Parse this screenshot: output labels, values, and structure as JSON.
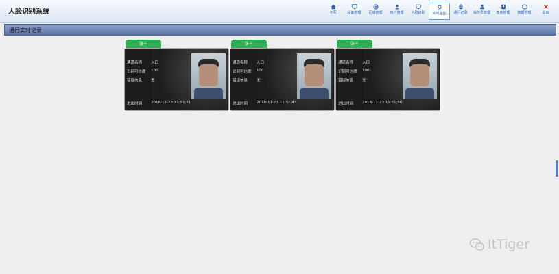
{
  "app": {
    "title": "人脸识别系统"
  },
  "nav": [
    {
      "label": "主页",
      "icon": "home-icon"
    },
    {
      "label": "设备管理",
      "icon": "monitor-icon"
    },
    {
      "label": "区域管理",
      "icon": "area-icon"
    },
    {
      "label": "用户管理",
      "icon": "user-icon"
    },
    {
      "label": "人脸识别",
      "icon": "face-icon"
    },
    {
      "label": "实时监控",
      "icon": "camera-icon",
      "active": true
    },
    {
      "label": "通行记录",
      "icon": "record-icon"
    },
    {
      "label": "操作员管理",
      "icon": "operator-icon"
    },
    {
      "label": "角色管理",
      "icon": "role-icon"
    },
    {
      "label": "数据管理",
      "icon": "data-icon"
    },
    {
      "label": "退出",
      "icon": "close-icon"
    }
  ],
  "section": {
    "title": "通行实时记录"
  },
  "cards": [
    {
      "name": "张三",
      "channel_label": "通道名称",
      "channel_value": "入口",
      "confidence_label": "识别可信度",
      "confidence_value": "100",
      "error_label": "错误信息",
      "error_value": "无",
      "time_label": "进出时间",
      "time_value": "2018-11-23 11:51:21"
    },
    {
      "name": "张三",
      "channel_label": "通道名称",
      "channel_value": "入口",
      "confidence_label": "识别可信度",
      "confidence_value": "100",
      "error_label": "错误信息",
      "error_value": "无",
      "time_label": "进出时间",
      "time_value": "2018-11-23 11:51:43"
    },
    {
      "name": "张三",
      "channel_label": "通道名称",
      "channel_value": "入口",
      "confidence_label": "识别可信度",
      "confidence_value": "100",
      "error_label": "错误信息",
      "error_value": "无",
      "time_label": "进出时间",
      "time_value": "2018-11-23 11:51:50"
    }
  ],
  "watermark": {
    "text": "ItTiger",
    "icon": "wechat-icon"
  },
  "colors": {
    "accent": "#2a5da8",
    "tag": "#2fae55",
    "section": "#6b82b3"
  }
}
